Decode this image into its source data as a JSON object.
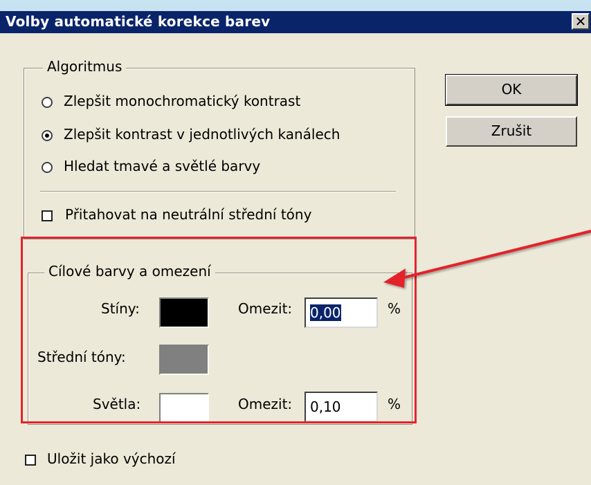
{
  "window": {
    "title": "Volby automatické korekce barev",
    "close": "✕"
  },
  "buttons": {
    "ok": "OK",
    "cancel": "Zrušit"
  },
  "algorithm": {
    "legend": "Algoritmus",
    "options": [
      {
        "label": "Zlepšit monochromatický kontrast",
        "selected": false
      },
      {
        "label": "Zlepšit kontrast v jednotlivých kanálech",
        "selected": true
      },
      {
        "label": "Hledat tmavé a světlé barvy",
        "selected": false
      }
    ],
    "snap_neutral": {
      "label": "Přitahovat na neutrální střední tóny",
      "checked": false
    }
  },
  "targets": {
    "legend": "Cílové barvy a omezení",
    "shadows": {
      "label": "Stíny:",
      "color": "#000000",
      "clip_label": "Omezit:",
      "clip_value": "0,00",
      "unit": "%"
    },
    "midtones": {
      "label": "Střední tóny:",
      "color": "#808080"
    },
    "highlights": {
      "label": "Světla:",
      "color": "#ffffff",
      "clip_label": "Omezit:",
      "clip_value": "0,10",
      "unit": "%"
    }
  },
  "save_default": {
    "label": "Uložit jako výchozí",
    "checked": false
  },
  "colors": {
    "annotation": "#e3242b",
    "titlebar": "#0a246a"
  }
}
